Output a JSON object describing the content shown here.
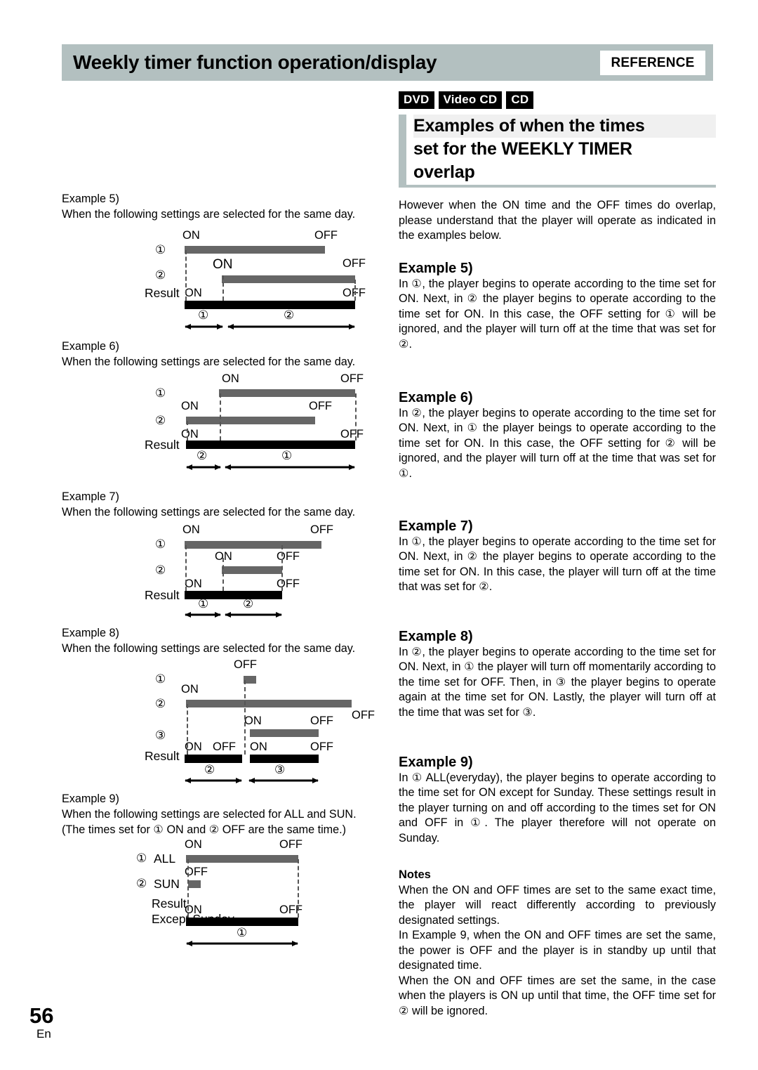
{
  "header": {
    "title": "Weekly timer function operation/display",
    "reference_label": "REFERENCE"
  },
  "disc_badges": [
    "DVD",
    "Video CD",
    "CD"
  ],
  "section": {
    "title_line1": "Examples of when the times",
    "title_line2": "set for the WEEKLY TIMER",
    "title_line3": "overlap"
  },
  "right_column": {
    "intro": "However when the ON time and the OFF times do overlap, please understand that the player will operate as indicated in the examples below.",
    "examples": [
      {
        "heading": "Example 5)",
        "body": "In ①, the player begins to operate according to the time set for ON.  Next, in ② the player begins to operate according to the time set for ON.  In this case, the OFF setting for ① will be ignored, and the player will turn off at the time that was set for ②."
      },
      {
        "heading": "Example 6)",
        "body": "In ②, the player begins to operate according to the time set for ON.  Next, in ① the player beings to operate according to the time set for ON.  In this case, the OFF setting for ② will be ignored, and the player will turn off at the time that was set for ①."
      },
      {
        "heading": "Example 7)",
        "body": "In ①, the player begins to operate according to the time set for ON.  Next, in ② the player begins to operate according to the time set for ON.  In this case, the player will turn off at the time that was set for ②."
      },
      {
        "heading": "Example 8)",
        "body": "In ②, the player begins to operate according to the time set for ON.  Next, in ① the player will turn off momentarily according to the time set for OFF.  Then, in ③ the player begins to operate again at the time set for ON.  Lastly, the player will turn off at the time that was set for ③."
      },
      {
        "heading": "Example 9)",
        "body": "In ① ALL(everyday), the player begins to operate according to the time set for ON except for Sunday. These settings result in the player turning on and off according to the times set for ON and OFF in ①.  The player therefore will not operate on Sunday."
      }
    ],
    "notes_heading": "Notes",
    "notes": [
      "When the ON and OFF times are set to the same exact time, the player will react differently according to previously designated settings.",
      "In Example 9, when the ON and OFF times are set the same, the power is OFF and the player is in standby up until that designated time.",
      "When the ON and OFF times are set the same, in the case when the players is ON up until that time, the OFF time set for ② will be ignored."
    ]
  },
  "left_column": {
    "examples": [
      {
        "heading": "Example 5)",
        "subtitle": "When the following settings are selected for the same day."
      },
      {
        "heading": "Example 6)",
        "subtitle": "When the following settings are selected for the same day."
      },
      {
        "heading": "Example 7)",
        "subtitle": "When the following settings are selected for the same day."
      },
      {
        "heading": "Example 8)",
        "subtitle": "When the following settings are selected for the same day."
      },
      {
        "heading": "Example 9)",
        "subtitle_line1": "When the following settings are selected for ALL and SUN.",
        "subtitle_line2": "(The times set for ① ON and ② OFF are the same time.)"
      }
    ],
    "diagram_labels": {
      "on": "ON",
      "off": "OFF",
      "result": "Result",
      "result_except_sunday_line1": "Result",
      "result_except_sunday_line2": "Except Sunday",
      "row1": "①",
      "row2": "②",
      "row3": "③",
      "all": "ALL",
      "sun": "SUN"
    }
  },
  "footer": {
    "page_number": "56",
    "language": "En"
  },
  "colors": {
    "header_band": "#b3c0c0",
    "bar_gray": "#666666",
    "bar_black": "#000000",
    "badge_bg": "#000000"
  }
}
